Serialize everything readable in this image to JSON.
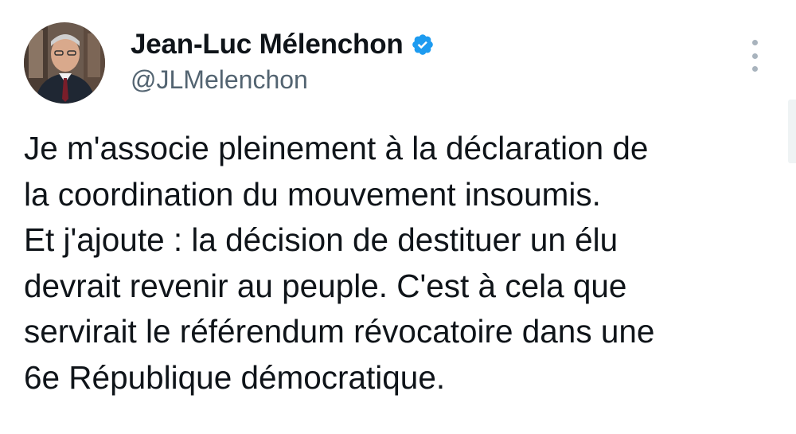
{
  "author": {
    "display_name": "Jean-Luc Mélenchon",
    "handle": "@JLMelenchon",
    "verified_icon": "verified-badge-icon",
    "avatar": "profile-photo"
  },
  "menu": {
    "icon": "more-options-icon"
  },
  "tweet": {
    "lines": [
      "Je m'associe pleinement à la déclaration de",
      "la coordination du mouvement insoumis.",
      "Et j'ajoute : la décision de destituer un élu",
      "devrait revenir au peuple. C'est à cela que",
      "servirait le référendum révocatoire dans une",
      "6e République démocratique."
    ]
  },
  "colors": {
    "text": "#0f1419",
    "secondary_text": "#536471",
    "verified_blue": "#1d9bf0",
    "menu_dots": "#a8b3bd"
  }
}
